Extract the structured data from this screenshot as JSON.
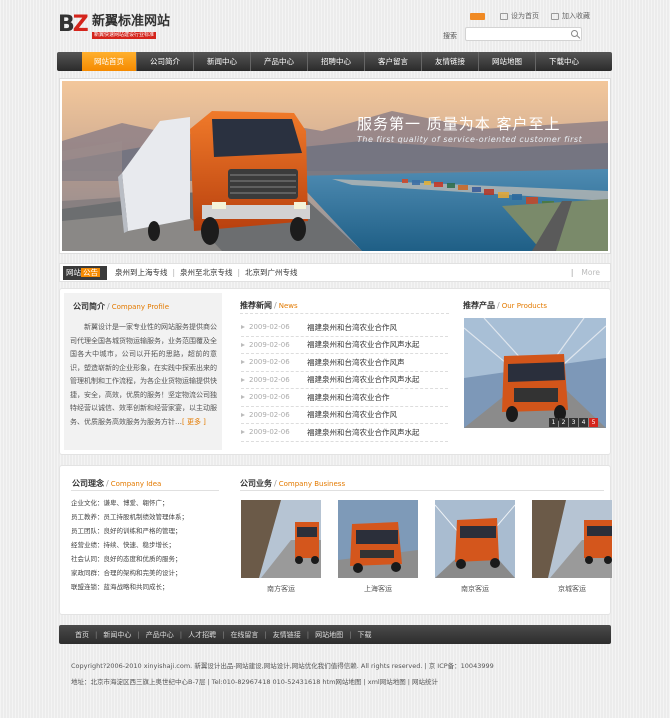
{
  "header": {
    "logo_mark_b": "B",
    "logo_mark_z": "Z",
    "logo_title": "新翼标准网站",
    "logo_sub": "新翼快速网站建设行业标准",
    "links": [
      {
        "label": "",
        "icon": "rss-icon"
      },
      {
        "label": "设为首页",
        "icon": "home-icon"
      },
      {
        "label": "加入收藏",
        "icon": "favorite-icon"
      }
    ],
    "search_label": "搜索",
    "search_value": ""
  },
  "nav": {
    "items": [
      "网站首页",
      "公司简介",
      "新闻中心",
      "产品中心",
      "招聘中心",
      "客户留言",
      "友情链接",
      "网站地图",
      "下载中心"
    ],
    "active_index": 0
  },
  "banner": {
    "title_line": "服务第一  质量为本  客户至上",
    "subtitle": "The first quality of service-oriented customer first"
  },
  "notice": {
    "tag_a": "网站",
    "tag_b": "公告",
    "links": [
      "泉州到上海专线",
      "泉州至北京专线",
      "北京到广州专线"
    ],
    "more": "More"
  },
  "company_intro": {
    "title": "公司简介",
    "title_en": "Company Profile",
    "text": "新翼设计是一家专业性的网站服务提供商公司代理全国各城货物运输服务，业务范围覆及全国各大中城市，公司以开拓的思路，超前的意识，塑造崭新的企业形象，在实践中探索出来的管理机制和工作流程，为各企业货物运输提供快捷，安全，高效，优质的服务！坚定物流公司独特经营以诚信、效率创新和经营家宴，以主动服务、优质服务高效服务为服务方针…",
    "more": "[ 更多 ]"
  },
  "news": {
    "title": "推荐新闻",
    "title_en": "News",
    "items": [
      {
        "date": "2009-02-06",
        "title": "福建泉州和台湾农业合作风"
      },
      {
        "date": "2009-02-06",
        "title": "福建泉州和台湾农业合作风声水起"
      },
      {
        "date": "2009-02-06",
        "title": "福建泉州和台湾农业合作风声"
      },
      {
        "date": "2009-02-06",
        "title": "福建泉州和台湾农业合作风声水起"
      },
      {
        "date": "2009-02-06",
        "title": "福建泉州和台湾农业合作"
      },
      {
        "date": "2009-02-06",
        "title": "福建泉州和台湾农业合作风"
      },
      {
        "date": "2009-02-06",
        "title": "福建泉州和台湾农业合作风声水起"
      }
    ]
  },
  "products": {
    "title": "推荐产品",
    "title_en": "Our Products",
    "pages": [
      "1",
      "2",
      "3",
      "4",
      "5"
    ],
    "active_page": 4
  },
  "idea": {
    "title": "公司理念",
    "title_en": "Company Idea",
    "items": [
      "企业文化：谦卑、博爱、翱怀广；",
      "员工教养：员工持股机制绩效管理体系；",
      "员工团队：良好的训练和严格的管理；",
      "经营业绩：持续、快速、稳步增长；",
      "社会认同：良好的态度和优质的服务；",
      "家政同群：合理的架构和完美的设计；",
      "联盟连锁：蓝海战略和共同成长；"
    ]
  },
  "business": {
    "title": "公司业务",
    "title_en": "Company Business",
    "items": [
      "南方客运",
      "上海客运",
      "南京客运",
      "京城客运"
    ]
  },
  "footer": {
    "links": [
      "首页",
      "新闻中心",
      "产品中心",
      "人才招聘",
      "在线留言",
      "友情链接",
      "网站地图",
      "下载"
    ],
    "copyright": "Copyright?2006-2010 xinyishaji.com. 新翼设计出品-网站建设,网站设计,网站优化我们值得信赖. All rights reserved.   |   京 ICP备：10043999",
    "address": "地址：北京市海淀区西三旗上奥世纪中心B-7层  | Tel:010-82967418 010-52431618 htm网站地图 | xml网站地图 | 网站统计"
  },
  "colors": {
    "accent_orange": "#f58a00",
    "brand_red": "#d4251c",
    "nav_dark": "#333333"
  }
}
